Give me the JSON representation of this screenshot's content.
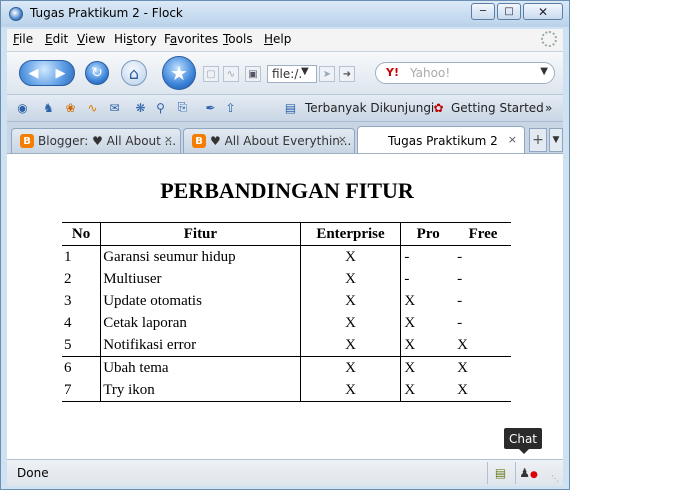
{
  "window": {
    "title": "Tugas Praktikum 2 - Flock"
  },
  "menu": {
    "file": {
      "u": "F",
      "rest": "ile"
    },
    "edit": {
      "u": "E",
      "rest": "dit"
    },
    "view": {
      "u": "V",
      "rest": "iew"
    },
    "history": {
      "u": "",
      "pre": "Hi",
      "us": "s",
      "rest": "tory"
    },
    "favorites": {
      "pre": "F",
      "us": "a",
      "rest": "vorites"
    },
    "tools": {
      "u": "T",
      "rest": "ools"
    },
    "help": {
      "u": "H",
      "rest": "elp"
    }
  },
  "navbar": {
    "url": "file:/.",
    "search_placeholder": "Yahoo!",
    "search_brand": "Y!"
  },
  "favbar": {
    "link1": "Terbanyak Dikunjungi",
    "link2": "Getting Started",
    "more": "»"
  },
  "tabs": [
    {
      "label": "Blogger: ♥ All About ...",
      "close": "×"
    },
    {
      "label": "♥ All About Everythin...",
      "close": "×"
    },
    {
      "label": "Tugas Praktikum 2",
      "close": "×"
    }
  ],
  "page": {
    "title": "PERBANDINGAN FITUR",
    "headers": {
      "no": "No",
      "fitur": "Fitur",
      "enterprise": "Enterprise",
      "pro": "Pro",
      "free": "Free"
    },
    "rows": [
      {
        "no": "1",
        "fitur": "Garansi seumur hidup",
        "enterprise": "X",
        "pro": "-",
        "free": "-"
      },
      {
        "no": "2",
        "fitur": "Multiuser",
        "enterprise": "X",
        "pro": "-",
        "free": "-"
      },
      {
        "no": "3",
        "fitur": "Update otomatis",
        "enterprise": "X",
        "pro": "X",
        "free": "-"
      },
      {
        "no": "4",
        "fitur": "Cetak laporan",
        "enterprise": "X",
        "pro": "X",
        "free": "-"
      },
      {
        "no": "5",
        "fitur": "Notifikasi error",
        "enterprise": "X",
        "pro": "X",
        "free": "X"
      },
      {
        "no": "6",
        "fitur": "Ubah tema",
        "enterprise": "X",
        "pro": "X",
        "free": "X"
      },
      {
        "no": "7",
        "fitur": "Try ikon",
        "enterprise": "X",
        "pro": "X",
        "free": "X"
      }
    ]
  },
  "status": {
    "text": "Done",
    "tooltip": "Chat"
  }
}
